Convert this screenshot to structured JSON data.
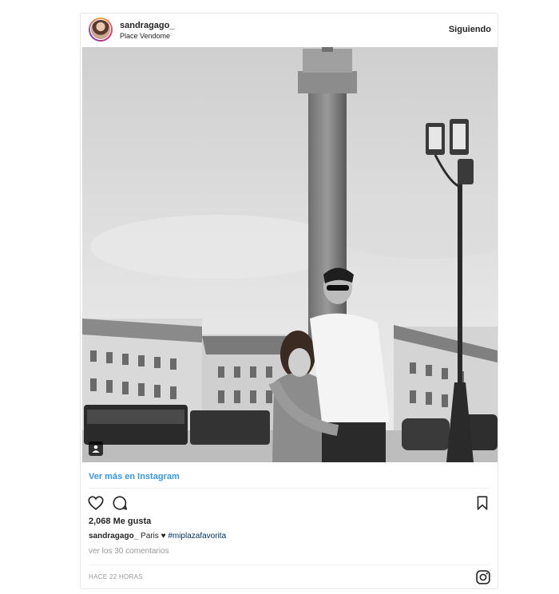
{
  "post": {
    "username": "sandragago_",
    "location": "Place Vendome",
    "follow_label": "Siguiendo",
    "view_more": "Ver más en Instagram",
    "likes": "2,068 Me gusta",
    "caption_user": "sandragago_",
    "caption_text": " Paris ",
    "caption_heart": "♥",
    "caption_hashtag": "#miplazafavorita",
    "comments_link": "ver los 30 comentarios",
    "timestamp": "HACE 22 HORAS"
  },
  "icons": {
    "like": "heart-icon",
    "comment": "comment-icon",
    "save": "bookmark-icon",
    "brand": "instagram-icon",
    "multi": "user-tag-icon"
  },
  "colors": {
    "link": "#3897f0",
    "text": "#262626",
    "muted": "#999999",
    "hashtag": "#003569",
    "border": "#e6e6e6"
  }
}
